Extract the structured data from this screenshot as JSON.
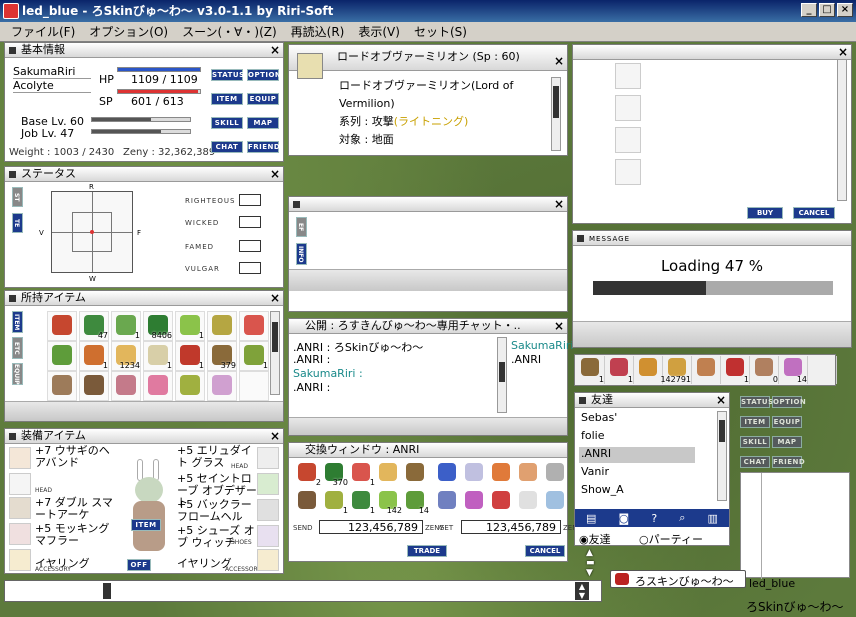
{
  "app": {
    "title": "led_blue - ろSkinびゅ～わ～ v3.0-1.1 by Riri-Soft"
  },
  "menu": [
    "ファイル(F)",
    "オプション(O)",
    "スーン(・∀・)(Z)",
    "再読込(R)",
    "表示(V)",
    "セット(S)"
  ],
  "basic": {
    "title": "基本情報",
    "name": "SakumaRiri",
    "job": "Acolyte",
    "hp_label": "HP",
    "hp": "1109 / 1109",
    "hp_ratio": 1.0,
    "sp_label": "SP",
    "sp": "601 / 613",
    "sp_ratio": 0.98,
    "base": "Base Lv. 60",
    "joblv": "Job Lv. 47",
    "weight": "Weight : 1003 / 2430",
    "zeny": "Zeny : 32,362,389",
    "buttons": [
      "STATUS",
      "OPTION",
      "ITEM",
      "EQUIP",
      "SKILL",
      "MAP",
      "CHAT",
      "FRIEND"
    ]
  },
  "status": {
    "title": "ステータス",
    "tabs": [
      "ST",
      "TE"
    ],
    "axis": {
      "r": "R",
      "v": "V",
      "f": "F",
      "w": "W"
    },
    "traits": [
      "RIGHTEOUS",
      "WICKED",
      "FAMED",
      "VULGAR"
    ]
  },
  "inventory": {
    "title": "所持アイテム",
    "tabs": [
      "ITEM",
      "ETC",
      "EQUIP"
    ],
    "counts": [
      "",
      "47",
      "1",
      "8406",
      "1",
      "",
      "",
      "",
      "1",
      "1234",
      "1",
      "1",
      "379",
      "1",
      "",
      "",
      "",
      "",
      "",
      "",
      ""
    ]
  },
  "equip": {
    "title": "装備アイテム",
    "left": [
      "+7 ウサギのヘアバンド",
      "",
      "+7 ダブル スマートアーケ",
      "+5 モッキング マフラー",
      "イヤリング"
    ],
    "right": [
      "+5 エリュダイト グラス",
      "+5 セイントローブ オブデザート",
      "+5 バックラー フロームヘル",
      "+5 シューズ オブ ウィッチ",
      "イヤリング"
    ],
    "slot_labels": [
      "HEAD",
      "HEAD",
      "ACCESSORY",
      "SHOES",
      "ACCESSORY"
    ],
    "toggle_item": "ITEM",
    "toggle_off": "OFF"
  },
  "skill": {
    "title": "ロードオブヴァーミリオン (Sp : 60)",
    "name": "ロードオブヴァーミリオン(Lord of Vermilion)",
    "type_label": "系列 : ",
    "type_value": "攻撃",
    "type_element": "(ライトニング)",
    "target": "対象 : 地面"
  },
  "mini": {
    "tabs": [
      "EF",
      "INFO"
    ]
  },
  "chat": {
    "title": "公開 : ろすきんびゅ～わ～専用チャット・..",
    "lines": [
      ".ANRI : ろSkinびゅ～わ～",
      ".ANRI :",
      "SakumaRiri :",
      ".ANRI :"
    ],
    "members": [
      "SakumaRiri",
      ".ANRI"
    ]
  },
  "trade": {
    "title": "交換ウィンドウ : ANRI",
    "left_counts": [
      "2",
      "370",
      "1",
      "",
      "",
      "",
      "1",
      "1",
      "142",
      "14"
    ],
    "send_label": "SEND",
    "send": "123,456,789",
    "zeny_label": "ZENY",
    "get_label": "GET",
    "get": "123,456,789",
    "trade_btn": "TRADE",
    "cancel_btn": "CANCEL"
  },
  "shop": {
    "buy": "BUY",
    "cancel": "CANCEL"
  },
  "message": {
    "title": "MESSAGE",
    "loading": "Loading 47 %",
    "progress": 0.47
  },
  "hotbar": {
    "counts": [
      "1",
      "1",
      "",
      "142791",
      "",
      "1",
      "0",
      "14",
      ""
    ]
  },
  "friends": {
    "title": "友達",
    "list": [
      "Sebas'",
      "folie",
      ".ANRI",
      "Vanir",
      "Show_A"
    ],
    "selected": 2,
    "radio": [
      "友達",
      "パーティー"
    ]
  },
  "minipanel": {
    "buttons": [
      "STATUS",
      "OPTION",
      "ITEM",
      "EQUIP",
      "SKILL",
      "MAP",
      "CHAT",
      "FRIEND"
    ]
  },
  "bottom": {
    "skin": "ろスキンびゅ～わ～",
    "led": "led_blue",
    "footer": "ろSkinびゅ～わ～"
  }
}
